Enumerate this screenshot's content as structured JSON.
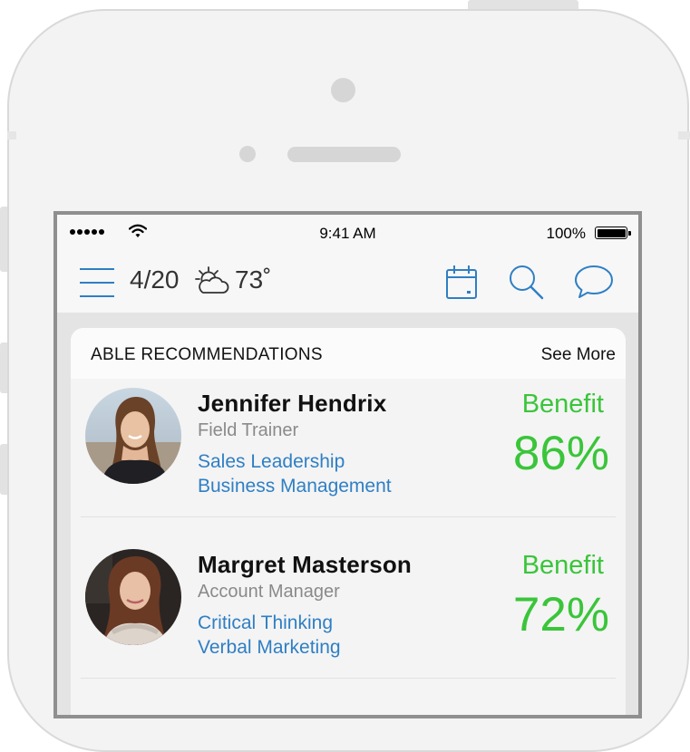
{
  "status_bar": {
    "time": "9:41 AM",
    "battery": "100%"
  },
  "nav": {
    "date": "4/20",
    "temperature": "73˚",
    "icons": [
      "menu-icon",
      "partly-cloudy-icon",
      "calendar-icon",
      "search-icon",
      "chat-icon"
    ]
  },
  "card": {
    "title": "ABLE RECOMMENDATIONS",
    "see_more": "See More"
  },
  "recommendations": [
    {
      "name": "Jennifer Hendrix",
      "role": "Field Trainer",
      "skills": [
        "Sales Leadership",
        "Business Management"
      ],
      "benefit_label": "Benefit",
      "benefit_value": "86%"
    },
    {
      "name": "Margret Masterson",
      "role": "Account Manager",
      "skills": [
        "Critical Thinking",
        "Verbal Marketing"
      ],
      "benefit_label": "Benefit",
      "benefit_value": "72%"
    }
  ],
  "colors": {
    "accent_blue": "#2f7fc4",
    "benefit_green": "#3ac53a",
    "skill_link": "#2f7fc4"
  }
}
